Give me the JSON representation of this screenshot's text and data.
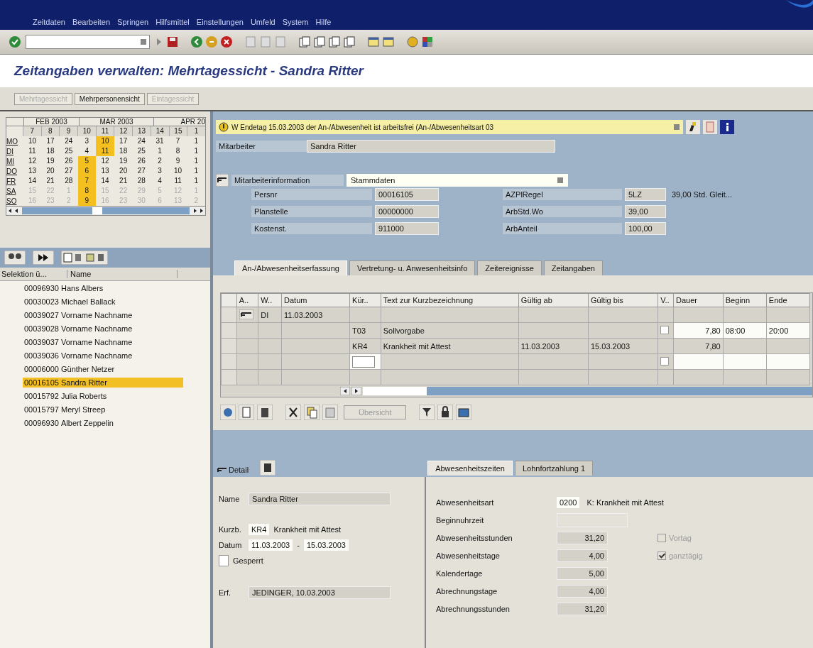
{
  "menu": [
    "Zeitdaten",
    "Bearbeiten",
    "Springen",
    "Hilfsmittel",
    "Einstellungen",
    "Umfeld",
    "System",
    "Hilfe"
  ],
  "title": "Zeitangaben verwalten: Mehrtagessicht - Sandra Ritter",
  "views": [
    {
      "label": "Mehrtagessicht",
      "disabled": true
    },
    {
      "label": "Mehrpersonensicht",
      "disabled": false
    },
    {
      "label": "Eintagessicht",
      "disabled": true
    }
  ],
  "calendar": {
    "months": [
      "FEB 2003",
      "MAR 2003",
      "APR 20"
    ],
    "weeks": [
      "7",
      "8",
      "9",
      "10",
      "11",
      "12",
      "13",
      "14",
      "15",
      "1"
    ],
    "days": [
      {
        "label": "MO",
        "weekend": false,
        "cells": [
          {
            "d": "10",
            "selected": false
          },
          {
            "d": "17",
            "selected": false
          },
          {
            "d": "24",
            "selected": false
          },
          {
            "d": "3",
            "selected": false
          },
          {
            "d": "10",
            "selected": true
          },
          {
            "d": "17",
            "selected": false
          },
          {
            "d": "24",
            "selected": false
          },
          {
            "d": "31",
            "selected": false
          },
          {
            "d": "7",
            "selected": false
          },
          {
            "d": "1",
            "selected": false
          }
        ]
      },
      {
        "label": "DI",
        "weekend": false,
        "cells": [
          {
            "d": "11",
            "selected": false
          },
          {
            "d": "18",
            "selected": false
          },
          {
            "d": "25",
            "selected": false
          },
          {
            "d": "4",
            "selected": false
          },
          {
            "d": "11",
            "selected": true
          },
          {
            "d": "18",
            "selected": false
          },
          {
            "d": "25",
            "selected": false
          },
          {
            "d": "1",
            "selected": false
          },
          {
            "d": "8",
            "selected": false
          },
          {
            "d": "1",
            "selected": false
          }
        ]
      },
      {
        "label": "MI",
        "weekend": false,
        "cells": [
          {
            "d": "12",
            "selected": false
          },
          {
            "d": "19",
            "selected": false
          },
          {
            "d": "26",
            "selected": false
          },
          {
            "d": "5",
            "selected": true
          },
          {
            "d": "12",
            "selected": false
          },
          {
            "d": "19",
            "selected": false
          },
          {
            "d": "26",
            "selected": false
          },
          {
            "d": "2",
            "selected": false
          },
          {
            "d": "9",
            "selected": false
          },
          {
            "d": "1",
            "selected": false
          }
        ]
      },
      {
        "label": "DO",
        "weekend": false,
        "cells": [
          {
            "d": "13",
            "selected": false
          },
          {
            "d": "20",
            "selected": false
          },
          {
            "d": "27",
            "selected": false
          },
          {
            "d": "6",
            "selected": true
          },
          {
            "d": "13",
            "selected": false
          },
          {
            "d": "20",
            "selected": false
          },
          {
            "d": "27",
            "selected": false
          },
          {
            "d": "3",
            "selected": false
          },
          {
            "d": "10",
            "selected": false
          },
          {
            "d": "1",
            "selected": false
          }
        ]
      },
      {
        "label": "FR",
        "weekend": false,
        "cells": [
          {
            "d": "14",
            "selected": false
          },
          {
            "d": "21",
            "selected": false
          },
          {
            "d": "28",
            "selected": false
          },
          {
            "d": "7",
            "selected": true
          },
          {
            "d": "14",
            "selected": false
          },
          {
            "d": "21",
            "selected": false
          },
          {
            "d": "28",
            "selected": false
          },
          {
            "d": "4",
            "selected": false
          },
          {
            "d": "11",
            "selected": false
          },
          {
            "d": "1",
            "selected": false
          }
        ]
      },
      {
        "label": "SA",
        "weekend": true,
        "cells": [
          {
            "d": "15",
            "selected": false
          },
          {
            "d": "22",
            "selected": false
          },
          {
            "d": "1",
            "selected": false
          },
          {
            "d": "8",
            "selected": true
          },
          {
            "d": "15",
            "selected": false
          },
          {
            "d": "22",
            "selected": false
          },
          {
            "d": "29",
            "selected": false
          },
          {
            "d": "5",
            "selected": false
          },
          {
            "d": "12",
            "selected": false
          },
          {
            "d": "1",
            "selected": false
          }
        ]
      },
      {
        "label": "SO",
        "weekend": true,
        "cells": [
          {
            "d": "16",
            "selected": false
          },
          {
            "d": "23",
            "selected": false
          },
          {
            "d": "2",
            "selected": false
          },
          {
            "d": "9",
            "selected": true
          },
          {
            "d": "16",
            "selected": false
          },
          {
            "d": "23",
            "selected": false
          },
          {
            "d": "30",
            "selected": false
          },
          {
            "d": "6",
            "selected": false
          },
          {
            "d": "13",
            "selected": false
          },
          {
            "d": "2",
            "selected": false
          }
        ]
      }
    ]
  },
  "employees": {
    "columns": [
      "Selektion ü...",
      "Name"
    ],
    "rows": [
      {
        "id": "00096930",
        "name": "Hans Albers",
        "selected": false
      },
      {
        "id": "00030023",
        "name": "Michael Ballack",
        "selected": false
      },
      {
        "id": "00039027",
        "name": "Vorname Nachname",
        "selected": false
      },
      {
        "id": "00039028",
        "name": "Vorname Nachname",
        "selected": false
      },
      {
        "id": "00039037",
        "name": "Vorname Nachname",
        "selected": false
      },
      {
        "id": "00039036",
        "name": "Vorname Nachname",
        "selected": false
      },
      {
        "id": "00006000",
        "name": "Günther Netzer",
        "selected": false
      },
      {
        "id": "00016105",
        "name": "Sandra Ritter",
        "selected": true
      },
      {
        "id": "00015792",
        "name": "Julia Roberts",
        "selected": false
      },
      {
        "id": "00015797",
        "name": "Meryl Streep",
        "selected": false
      },
      {
        "id": "00096930",
        "name": "Albert Zeppelin",
        "selected": false
      }
    ]
  },
  "message": "W Endetag 15.03.2003 der An-/Abwesenheit ist arbeitsfrei (An-/Abwesenheitsart 03",
  "employee": {
    "label": "Mitarbeiter",
    "value": "Sandra Ritter"
  },
  "info": {
    "label": "Mitarbeiterinformation",
    "value": "Stammdaten",
    "left": [
      {
        "label": "Persnr",
        "value": "00016105"
      },
      {
        "label": "Planstelle",
        "value": "00000000"
      },
      {
        "label": "Kostenst.",
        "value": "911000"
      }
    ],
    "right": [
      {
        "label": "AZPlRegel",
        "value": "5LZ",
        "extra": "39,00 Std. Gleit..."
      },
      {
        "label": "ArbStd.Wo",
        "value": "39,00"
      },
      {
        "label": "ArbAnteil",
        "value": "100,00"
      }
    ]
  },
  "tabs": [
    {
      "label": "An-/Abwesenheitserfassung",
      "selected": true
    },
    {
      "label": "Vertretung- u. Anwesenheitsinfo",
      "selected": false
    },
    {
      "label": "Zeitereignisse",
      "selected": false
    },
    {
      "label": "Zeitangaben",
      "selected": false
    }
  ],
  "table": {
    "columns": [
      "A..",
      "W..",
      "Datum",
      "Kür..",
      "Text zur Kurzbezeichnung",
      "Gültig ab",
      "Gültig bis",
      "V..",
      "Dauer",
      "Beginn",
      "Ende"
    ],
    "rows": [
      {
        "kind": "day",
        "weekday": "DI",
        "date": "11.03.2003"
      },
      {
        "kind": "entry",
        "code": "T03",
        "text": "Sollvorgabe",
        "from": "",
        "to": "",
        "checkbox": {
          "checked": false
        },
        "duration": "7,80",
        "begin": "08:00",
        "end": "20:00"
      },
      {
        "kind": "entry",
        "code": "KR4",
        "text": "Krankheit mit Attest",
        "from": "11.03.2003",
        "to": "15.03.2003",
        "duration": "7,80",
        "begin": "",
        "end": ""
      },
      {
        "kind": "input",
        "checkbox": {
          "checked": false
        }
      },
      {
        "kind": "empty"
      }
    ]
  },
  "table_toolbar": {
    "overview": "Übersicht"
  },
  "detail": {
    "title": "Detail",
    "name_label": "Name",
    "name": "Sandra Ritter",
    "code_label": "Kurzb.",
    "code": "KR4",
    "code_text": "Krankheit mit Attest",
    "date_label": "Datum",
    "date_sep": "-",
    "from": "11.03.2003",
    "to": "15.03.2003",
    "locked": {
      "label": "Gesperrt",
      "checked": false
    },
    "created_label": "Erf.",
    "created": "JEDINGER, 10.03.2003"
  },
  "detail_tabs": [
    {
      "label": "Abwesenheitszeiten",
      "selected": true
    },
    {
      "label": "Lohnfortzahlung 1",
      "selected": false
    }
  ],
  "absence": {
    "type_label": "Abwesenheitsart",
    "type": "0200",
    "type_text": "K: Krankheit mit Attest",
    "start_label": "Beginnuhrzeit",
    "rows": [
      {
        "label": "Abwesenheitsstunden",
        "value": "31,20"
      },
      {
        "label": "Abwesenheitstage",
        "value": "4,00"
      },
      {
        "label": "Kalendertage",
        "value": "5,00"
      },
      {
        "label": "Abrechnungstage",
        "value": "4,00"
      },
      {
        "label": "Abrechnungsstunden",
        "value": "31,20"
      }
    ],
    "options": [
      {
        "label": "Vortag",
        "checked": false
      },
      {
        "label": "ganztägig",
        "checked": true
      }
    ]
  }
}
